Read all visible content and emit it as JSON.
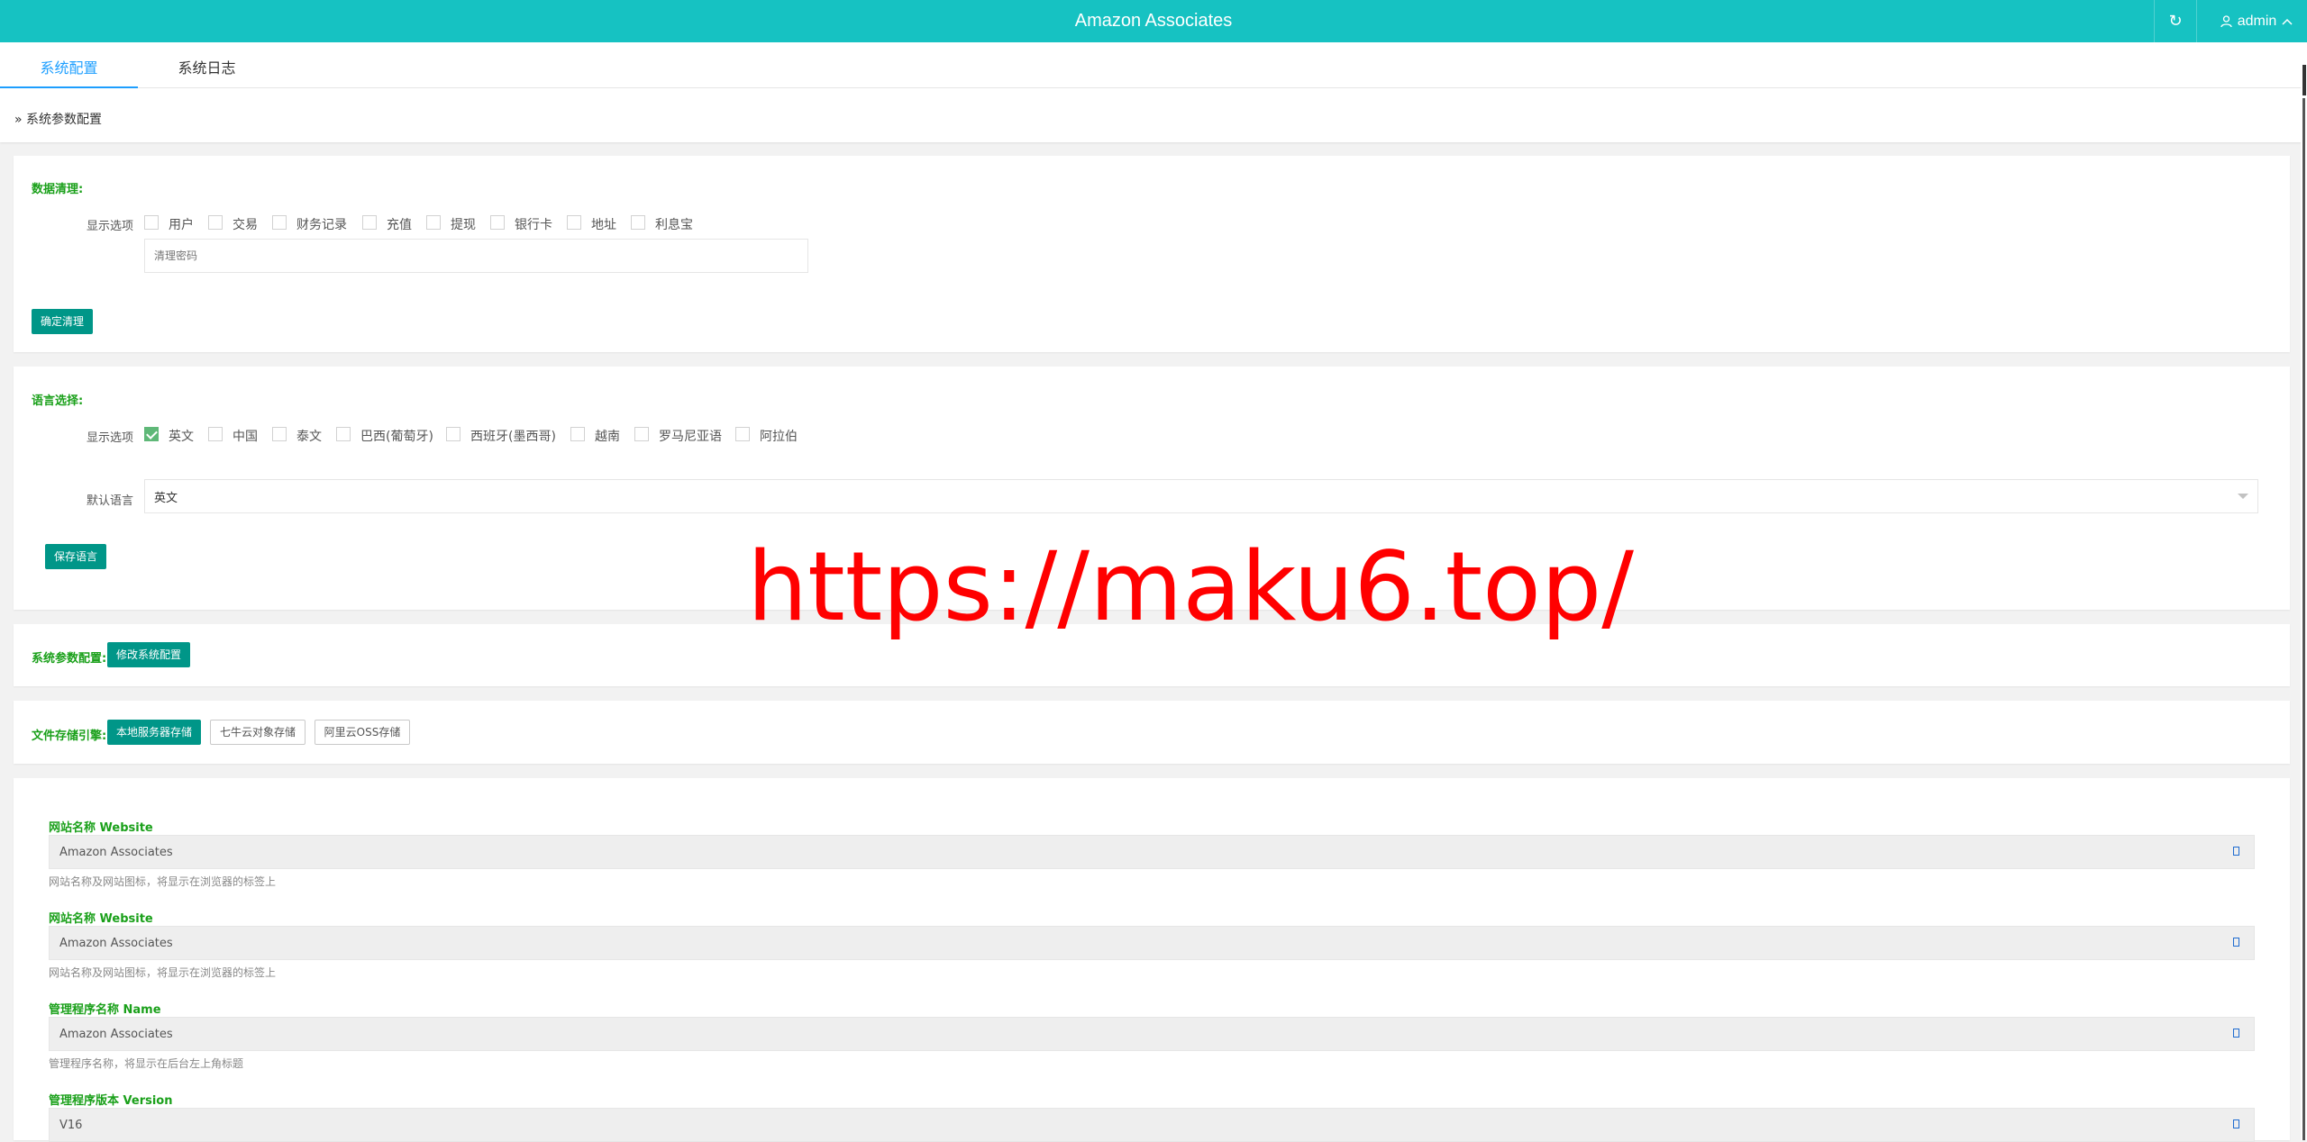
{
  "header": {
    "title": "Amazon Associates",
    "user": "admin"
  },
  "tabs": [
    {
      "label": "系统配置",
      "active": true
    },
    {
      "label": "系统日志",
      "active": false
    }
  ],
  "breadcrumb": "» 系统参数配置",
  "data_clear": {
    "title": "数据清理:",
    "options_label": "显示选项",
    "options": [
      "用户",
      "交易",
      "财务记录",
      "充值",
      "提现",
      "银行卡",
      "地址",
      "利息宝"
    ],
    "password_placeholder": "清理密码",
    "confirm_button": "确定清理"
  },
  "language": {
    "title": "语言选择:",
    "options_label": "显示选项",
    "options": [
      {
        "label": "英文",
        "checked": true
      },
      {
        "label": "中国",
        "checked": false
      },
      {
        "label": "泰文",
        "checked": false
      },
      {
        "label": "巴西(葡萄牙)",
        "checked": false
      },
      {
        "label": "西班牙(墨西哥)",
        "checked": false
      },
      {
        "label": "越南",
        "checked": false
      },
      {
        "label": "罗马尼亚语",
        "checked": false
      },
      {
        "label": "阿拉伯",
        "checked": false
      }
    ],
    "default_label": "默认语言",
    "default_value": "英文",
    "save_button": "保存语言"
  },
  "sys_params": {
    "title": "系统参数配置:",
    "edit_button": "修改系统配置"
  },
  "storage": {
    "title": "文件存储引擎:",
    "engines": [
      {
        "label": "本地服务器存储",
        "active": true
      },
      {
        "label": "七牛云对象存储",
        "active": false
      },
      {
        "label": "阿里云OSS存储",
        "active": false
      }
    ]
  },
  "fields": [
    {
      "title": "网站名称 Website",
      "value": "Amazon Associates",
      "hint": "网站名称及网站图标，将显示在浏览器的标签上"
    },
    {
      "title": "网站名称 Website",
      "value": "Amazon Associates",
      "hint": "网站名称及网站图标，将显示在浏览器的标签上"
    },
    {
      "title": "管理程序名称 Name",
      "value": "Amazon Associates",
      "hint": "管理程序名称，将显示在后台左上角标题"
    },
    {
      "title": "管理程序版本 Version",
      "value": "V16",
      "hint": ""
    }
  ],
  "watermark": "https://maku6.top/",
  "colors": {
    "header": "#16c2c2",
    "primary_button": "#009688",
    "section_title": "#1aa01a",
    "active_tab": "#1e9fff",
    "checked": "#5fb878"
  }
}
